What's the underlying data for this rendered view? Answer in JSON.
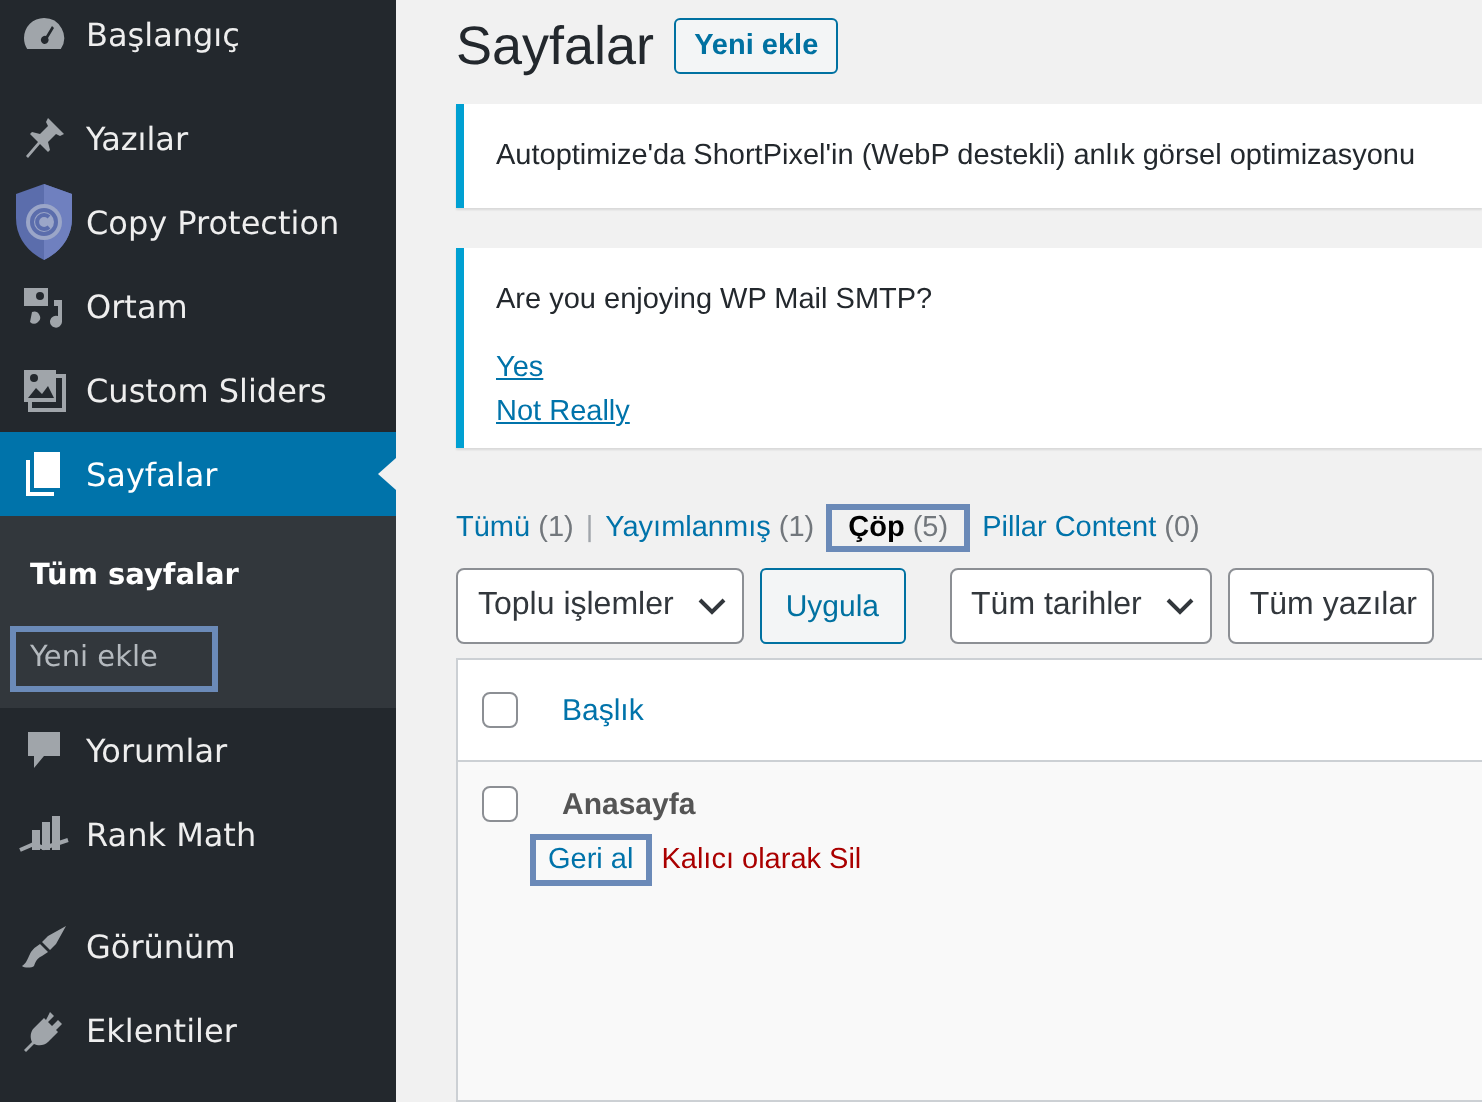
{
  "sidebar": {
    "menu_groups": [
      [
        {
          "label": "Başlangıç",
          "selected": false
        }
      ],
      [
        {
          "label": "Yazılar",
          "selected": false
        },
        {
          "label": "Copy Protection",
          "selected": false
        },
        {
          "label": "Ortam",
          "selected": false
        },
        {
          "label": "Custom Sliders",
          "selected": false
        },
        {
          "label": "Sayfalar",
          "selected": true,
          "submenu": [
            {
              "label": "Tüm sayfalar",
              "selected": true,
              "highlighted": false
            },
            {
              "label": "Yeni ekle",
              "selected": false,
              "highlighted": true
            }
          ]
        },
        {
          "label": "Yorumlar",
          "selected": false
        },
        {
          "label": "Rank Math",
          "selected": false
        }
      ],
      [
        {
          "label": "Görünüm",
          "selected": false
        },
        {
          "label": "Eklentiler",
          "selected": false
        }
      ]
    ]
  },
  "header": {
    "title": "Sayfalar",
    "add_button": "Yeni ekle"
  },
  "notices": [
    {
      "text": "Autoptimize'da ShortPixel'in (WebP destekli) anlık görsel optimizasyonu"
    },
    {
      "text": "Are you enjoying WP Mail SMTP?",
      "links": [
        "Yes",
        "Not Really"
      ]
    }
  ],
  "status_filters": [
    {
      "label": "Tümü",
      "count": "(1)",
      "selected": false,
      "highlighted": false,
      "separator": "|"
    },
    {
      "label": "Yayımlanmış",
      "count": "(1)",
      "selected": false,
      "highlighted": false
    },
    {
      "label": "Çöp",
      "count": "(5)",
      "selected": true,
      "highlighted": true
    },
    {
      "label": "Pillar Content",
      "count": "(0)",
      "selected": false,
      "highlighted": false
    }
  ],
  "toolbar": {
    "bulk_actions": "Toplu işlemler",
    "apply_button": "Uygula",
    "date_filter": "Tüm tarihler",
    "type_filter": "Tüm yazılar"
  },
  "table": {
    "columns": [
      {
        "label": "Başlık",
        "checked": false
      }
    ],
    "rows": [
      {
        "title": "Anasayfa",
        "checked": false,
        "actions": [
          {
            "label": "Geri al",
            "kind": "restore",
            "highlighted": true
          },
          {
            "label": "Kalıcı olarak Sil",
            "kind": "delete",
            "highlighted": false
          }
        ]
      }
    ]
  }
}
